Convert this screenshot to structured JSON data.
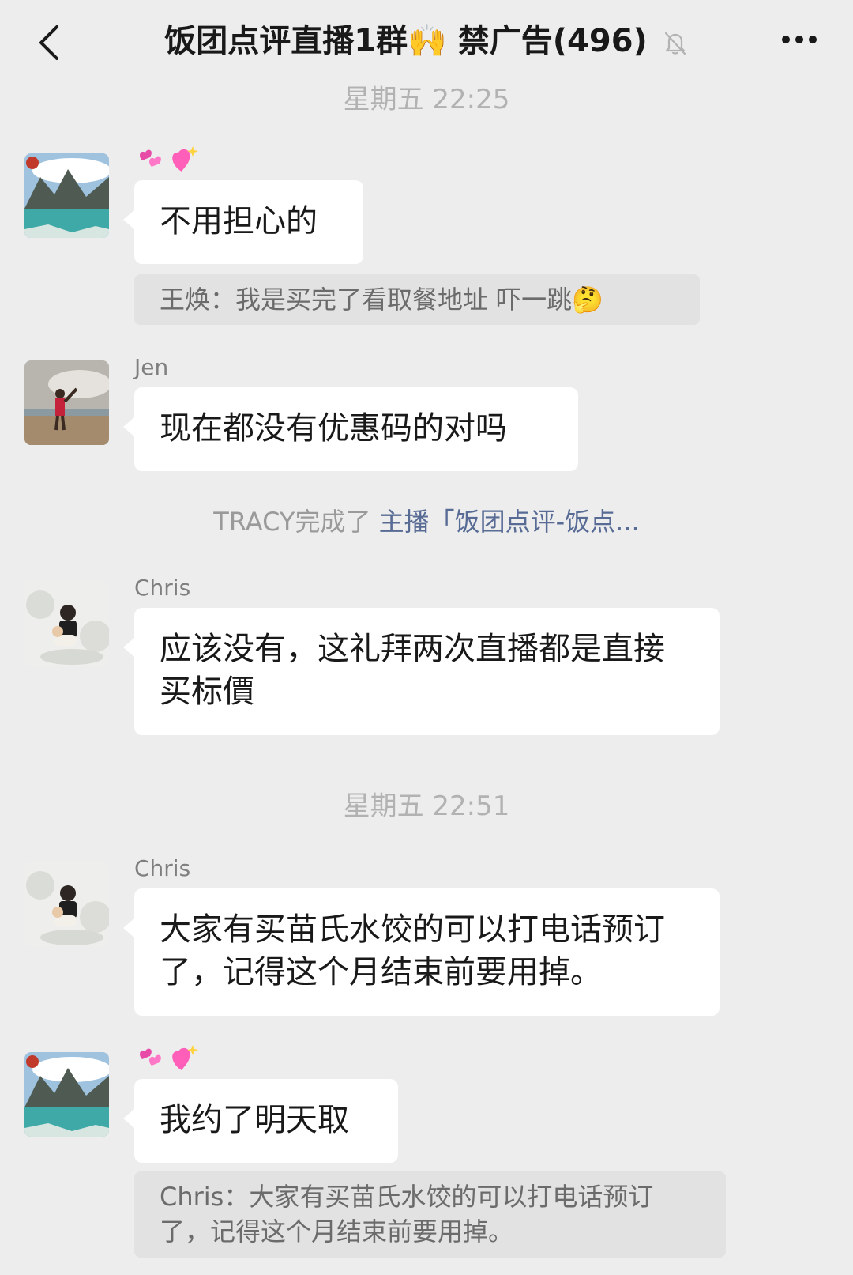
{
  "header": {
    "title": "饭团点评直播1群🙌 禁广告(496)",
    "back_icon": "chevron-left-icon",
    "mute_icon": "bell-slash-icon",
    "more_icon": "more-dots-icon"
  },
  "timestamps": [
    "星期五 22:25",
    "星期五 22:51"
  ],
  "messages": [
    {
      "sender": "💕💖",
      "text": "不用担心的",
      "quote": "王焕：我是买完了看取餐地址 吓一跳🤔"
    },
    {
      "sender": "Jen",
      "text": "现在都没有优惠码的对吗"
    },
    {
      "sender": "Chris",
      "text": "应该没有，这礼拜两次直播都是直接买标價"
    },
    {
      "sender": "Chris",
      "text": "大家有买苗氏水饺的可以打电话预订了，记得这个月结束前要用掉。"
    },
    {
      "sender": "💕💖",
      "text": "我约了明天取",
      "quote": "Chris：大家有买苗氏水饺的可以打电话预订了，记得这个月结束前要用掉。"
    }
  ],
  "system_note": {
    "prefix": "TRACY完成了 ",
    "link": "主播「饭团点评-饭点..."
  },
  "colors": {
    "background": "#ededed",
    "bubble": "#ffffff",
    "quote": "#e2e2e2",
    "link": "#576b95"
  }
}
